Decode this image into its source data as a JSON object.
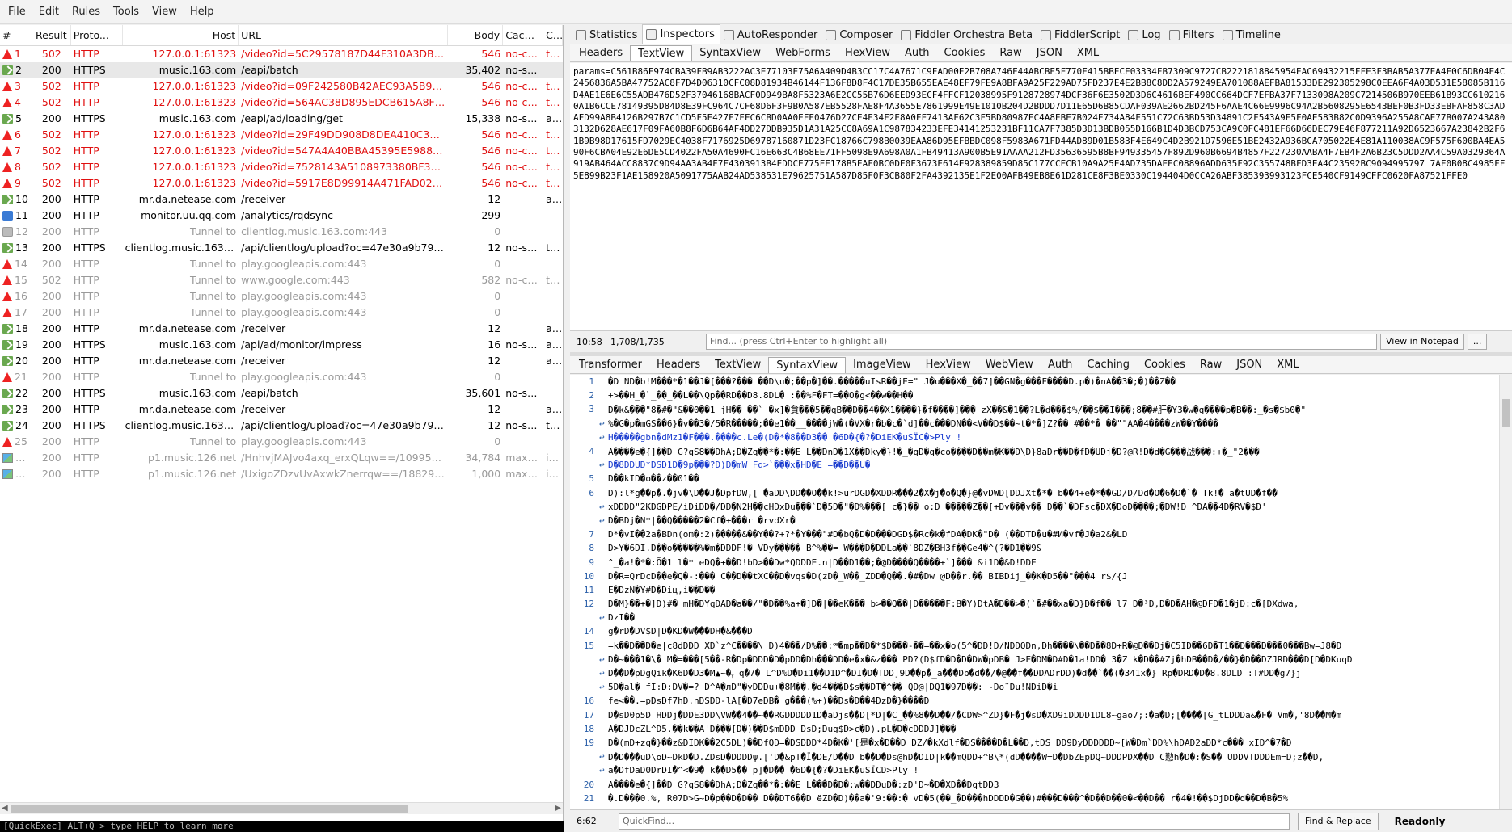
{
  "menu": [
    "File",
    "Edit",
    "Rules",
    "Tools",
    "View",
    "Help"
  ],
  "columns": [
    "#",
    "Result",
    "Proto...",
    "Host",
    "URL",
    "Body",
    "Caching",
    "Conte"
  ],
  "sessions": [
    {
      "icon": "warn",
      "num": "1",
      "result": "502",
      "proto": "HTTP",
      "host": "127.0.0.1:61323",
      "url": "/video?id=5C29578187D44F310A3DB27...",
      "body": "546",
      "caching": "no-ca...",
      "ctype": "text/h",
      "style": "err"
    },
    {
      "icon": "down",
      "num": "2",
      "result": "200",
      "proto": "HTTPS",
      "host": "music.163.com",
      "url": "/eapi/batch",
      "body": "35,402",
      "caching": "no-sto...",
      "ctype": "",
      "style": "sel"
    },
    {
      "icon": "warn",
      "num": "3",
      "result": "502",
      "proto": "HTTP",
      "host": "127.0.0.1:61323",
      "url": "/video?id=09F242580B42AEC93A5B9B6...",
      "body": "546",
      "caching": "no-ca...",
      "ctype": "text/h",
      "style": "err"
    },
    {
      "icon": "warn",
      "num": "4",
      "result": "502",
      "proto": "HTTP",
      "host": "127.0.0.1:61323",
      "url": "/video?id=564AC38D895EDCB615A8F4...",
      "body": "546",
      "caching": "no-ca...",
      "ctype": "text/h",
      "style": "err"
    },
    {
      "icon": "down",
      "num": "5",
      "result": "200",
      "proto": "HTTPS",
      "host": "music.163.com",
      "url": "/eapi/ad/loading/get",
      "body": "15,338",
      "caching": "no-sto...",
      "ctype": "applic",
      "style": ""
    },
    {
      "icon": "warn",
      "num": "6",
      "result": "502",
      "proto": "HTTP",
      "host": "127.0.0.1:61323",
      "url": "/video?id=29F49DD908D8DEA410C3CD...",
      "body": "546",
      "caching": "no-ca...",
      "ctype": "text/h",
      "style": "err"
    },
    {
      "icon": "warn",
      "num": "7",
      "result": "502",
      "proto": "HTTP",
      "host": "127.0.0.1:61323",
      "url": "/video?id=547A4A40BBA45395E598804...",
      "body": "546",
      "caching": "no-ca...",
      "ctype": "text/h",
      "style": "err"
    },
    {
      "icon": "warn",
      "num": "8",
      "result": "502",
      "proto": "HTTP",
      "host": "127.0.0.1:61323",
      "url": "/video?id=7528143A5108973380BF32D...",
      "body": "546",
      "caching": "no-ca...",
      "ctype": "text/h",
      "style": "err"
    },
    {
      "icon": "warn",
      "num": "9",
      "result": "502",
      "proto": "HTTP",
      "host": "127.0.0.1:61323",
      "url": "/video?id=5917E8D99914A471FAD0287...",
      "body": "546",
      "caching": "no-ca...",
      "ctype": "text/h",
      "style": "err"
    },
    {
      "icon": "down",
      "num": "10",
      "result": "200",
      "proto": "HTTP",
      "host": "mr.da.netease.com",
      "url": "/receiver",
      "body": "12",
      "caching": "",
      "ctype": "applic",
      "style": ""
    },
    {
      "icon": "info",
      "num": "11",
      "result": "200",
      "proto": "HTTP",
      "host": "monitor.uu.qq.com",
      "url": "/analytics/rqdsync",
      "body": "299",
      "caching": "",
      "ctype": "",
      "style": ""
    },
    {
      "icon": "tun",
      "num": "12",
      "result": "200",
      "proto": "HTTP",
      "host": "Tunnel to",
      "url": "clientlog.music.163.com:443",
      "body": "0",
      "caching": "",
      "ctype": "",
      "style": "tun"
    },
    {
      "icon": "down",
      "num": "13",
      "result": "200",
      "proto": "HTTPS",
      "host": "clientlog.music.163.com",
      "url": "/api/clientlog/upload?oc=47e30a9b79c...",
      "body": "12",
      "caching": "no-sto...",
      "ctype": "text/p",
      "style": ""
    },
    {
      "icon": "warn",
      "num": "14",
      "result": "200",
      "proto": "HTTP",
      "host": "Tunnel to",
      "url": "play.googleapis.com:443",
      "body": "0",
      "caching": "",
      "ctype": "",
      "style": "tun"
    },
    {
      "icon": "warn",
      "num": "15",
      "result": "502",
      "proto": "HTTP",
      "host": "Tunnel to",
      "url": "www.google.com:443",
      "body": "582",
      "caching": "no-ca...",
      "ctype": "text/h",
      "style": "tun"
    },
    {
      "icon": "warn",
      "num": "16",
      "result": "200",
      "proto": "HTTP",
      "host": "Tunnel to",
      "url": "play.googleapis.com:443",
      "body": "0",
      "caching": "",
      "ctype": "",
      "style": "tun"
    },
    {
      "icon": "warn",
      "num": "17",
      "result": "200",
      "proto": "HTTP",
      "host": "Tunnel to",
      "url": "play.googleapis.com:443",
      "body": "0",
      "caching": "",
      "ctype": "",
      "style": "tun"
    },
    {
      "icon": "down",
      "num": "18",
      "result": "200",
      "proto": "HTTP",
      "host": "mr.da.netease.com",
      "url": "/receiver",
      "body": "12",
      "caching": "",
      "ctype": "applic",
      "style": ""
    },
    {
      "icon": "down",
      "num": "19",
      "result": "200",
      "proto": "HTTPS",
      "host": "music.163.com",
      "url": "/api/ad/monitor/impress",
      "body": "16",
      "caching": "no-sto...",
      "ctype": "applic",
      "style": ""
    },
    {
      "icon": "down",
      "num": "20",
      "result": "200",
      "proto": "HTTP",
      "host": "mr.da.netease.com",
      "url": "/receiver",
      "body": "12",
      "caching": "",
      "ctype": "applic",
      "style": ""
    },
    {
      "icon": "warn",
      "num": "21",
      "result": "200",
      "proto": "HTTP",
      "host": "Tunnel to",
      "url": "play.googleapis.com:443",
      "body": "0",
      "caching": "",
      "ctype": "",
      "style": "tun"
    },
    {
      "icon": "down",
      "num": "22",
      "result": "200",
      "proto": "HTTPS",
      "host": "music.163.com",
      "url": "/eapi/batch",
      "body": "35,601",
      "caching": "no-sto...",
      "ctype": "",
      "style": ""
    },
    {
      "icon": "down",
      "num": "23",
      "result": "200",
      "proto": "HTTP",
      "host": "mr.da.netease.com",
      "url": "/receiver",
      "body": "12",
      "caching": "",
      "ctype": "applic",
      "style": ""
    },
    {
      "icon": "down",
      "num": "24",
      "result": "200",
      "proto": "HTTPS",
      "host": "clientlog.music.163.com",
      "url": "/api/clientlog/upload?oc=47e30a9b79c...",
      "body": "12",
      "caching": "no-sto...",
      "ctype": "text/p",
      "style": ""
    },
    {
      "icon": "warn",
      "num": "25",
      "result": "200",
      "proto": "HTTP",
      "host": "Tunnel to",
      "url": "play.googleapis.com:443",
      "body": "0",
      "caching": "",
      "ctype": "",
      "style": "tun"
    },
    {
      "icon": "img",
      "num": "101",
      "result": "200",
      "proto": "HTTP",
      "host": "p1.music.126.net",
      "url": "/HnhvjMAJvo4axq_erxQLqw==/109951...",
      "body": "34,784",
      "caching": "max-a...",
      "ctype": "image",
      "style": "tun"
    },
    {
      "icon": "img",
      "num": "102",
      "result": "200",
      "proto": "HTTP",
      "host": "p1.music.126.net",
      "url": "/UxigoZDzvUvAxwkZnerrqw==/188291...",
      "body": "1,000",
      "caching": "max-a...",
      "ctype": "image",
      "style": "tun"
    }
  ],
  "quickexec": "[QuickExec] ALT+Q > type HELP to learn more",
  "main_tabs": [
    {
      "label": "Statistics",
      "icon": "stopwatch-icon"
    },
    {
      "label": "Inspectors",
      "icon": "inspector-icon",
      "active": true
    },
    {
      "label": "AutoResponder",
      "icon": "lightning-icon"
    },
    {
      "label": "Composer",
      "icon": "pencil-icon"
    },
    {
      "label": "Fiddler Orchestra Beta",
      "icon": "fo-icon"
    },
    {
      "label": "FiddlerScript",
      "icon": "script-icon"
    },
    {
      "label": "Log",
      "icon": "log-icon"
    },
    {
      "label": "Filters",
      "icon": "checkbox-icon"
    },
    {
      "label": "Timeline",
      "icon": "timeline-icon"
    }
  ],
  "req_tabs": [
    "Headers",
    "TextView",
    "SyntaxView",
    "WebForms",
    "HexView",
    "Auth",
    "Cookies",
    "Raw",
    "JSON",
    "XML"
  ],
  "req_active": "TextView",
  "request_body": "params=C561B86F974CBA39FB9AB3222AC3E77103E75A6A409D4B3CC17C4A7671C9FAD00E2B708A746F44ABCBE5F770F415BBECE03334FB7309C9727CB2221818845954EAC69432215FFE3F3BAB5A377EA4F0C6DB04E4C2456836A5BA47752AC8F7D4D06310CFC08D81934B46144F136F8D8F4C17DE35B655EAE48EF79FE9A8BFA9A25F229AD75FD237E4E2BB8C8DD2A579249EA701088AEFBA81533DE292305298C0EEA6F4A03D531E58085B116D4AE1E6E6C55ADB476D52F37046168BACF0D949BA8F5323A6E2CC55B76D6EED93ECF4FFCF12038995F9128728974DCF36F6E3502D3D6C4616BEF490CC664DCF7EFBA37F7133098A209C7214506B970EEB61B93CC6102160A1B6CCE78149395D84D8E39FC964C7CF68D6F3F9B0A587EB5528FAE8F4A3655E7861999E49E1010B204D2BDDD7D11E65D6B85CDAF039AE2662BD245F6AAE4C66E9996C94A2B5608295E6543BEF0B3FD33EBFAF858C3ADAFD99A8B4126B297B7C1CD5F5E427F7FFC6CBD0AA0EFE0476D27CE4E34F2E8A0FF7413AF62C3F5BD80987EC4A8EBE7B024E734A84E551C72C63BD53D34891C2F543A9E5F0AE583B82C0D9396A255A8CAE77B007A243A803132D628AE617F09FA60B8F6D6B64AF4DD27DDB935D1A31A25CC8A69A1C987834233EFE34141253231BF11CA7F7385D3D13BDB055D166B1D4D3BCD753CA9C0FC481EF66D66DEC79E46F877211A92D6523667A23842B2F61B9B98D17615FD7029EC4038F7176925D69787160871D23FC18766C798B0039EAA86D95EFBBDC098F5983A671FD44AD89D01B583F4E649C4D2B921D7596E51BE2432A936BCA705022E4E81A110038AC9F575F600BA4EA590F6CBA04E92E6DE5CD4022FA50A4690FC16E663C4B68EE71FF5098E9A698A0A1FB49413A900B5E91AAAA212FD35636595B8BF949335457F892D960B6694B4857F227230AABA4F7EB4F2A6B23C5DDD2AA4C59A0329364A919AB464ACC8837C9D94AA3AB4F7F4303913B4EDDCE775FE178B5EAF0BC0DE0F3673E614E928389859D85C177CCECB10A9A25E4AD735DAEEC08896ADD635F92C355748BFD3EA4C23592BC9094995797 7AF0B08C4985FF5E899B23F1AE158920A5091775AAB24AD538531E79625751A587D85F0F3CB80F2FA4392135E1F2E00AFB49EB8E61D281CE8F3BE0330C194404D0CCA26ABF385393993123FCE540CF9149CFFC0620FA87521FFE0",
  "find_pos": "10:58",
  "find_count": "1,708/1,735",
  "find_placeholder": "Find... (press Ctrl+Enter to highlight all)",
  "notepad_btn": "View in Notepad",
  "more_btn": "...",
  "resp_tabs": [
    "Transformer",
    "Headers",
    "TextView",
    "SyntaxView",
    "ImageView",
    "HexView",
    "WebView",
    "Auth",
    "Caching",
    "Cookies",
    "Raw",
    "JSON",
    "XML"
  ],
  "resp_active": "SyntaxView",
  "code_lines": [
    {
      "n": "1",
      "w": "",
      "t": "�D ND�b!M���*�1��J�[���?���  ��D\\u�;��p�]��.�����uIsR��jE=\" J�u���X�_��7]��GN�g���F����D.p�)�nA��3�;�)��Z��",
      "c": ""
    },
    {
      "n": "2",
      "w": "",
      "t": "+>��H_�`_��_��L��\\Qp��RD��D8.8DL� :��%F�FT=��O�g<��w��H��",
      "c": ""
    },
    {
      "n": "3",
      "w": "",
      "t": "D�k&���\"8�#�\"&��0��1 jH�� ��` �x]�貟���5��qB��D��4��X1����}�f����]��� zX��&�1��?L�d���$%/��$��I���;8��#肝�Y3�w�q����p�B��:_�s�$b0�\"",
      "c": ""
    },
    {
      "n": "",
      "w": "↩",
      "t": "  %�G�p�mGS��6}�v��3�/5�R�����;��e1��__����jW�(�VX�r�b�c�`d]��c���DN��<V��D$��~t�*�]Z?��  #��*� ��\"\"AA�4����zW��Y����",
      "c": ""
    },
    {
      "n": "",
      "w": "↩",
      "t": "H�����gbn�dMz1�F���.����c.Le�(D�*�8��D3��   �6D�{�?�DiEK�uSÏC�>Ply    !",
      "c": "blue"
    },
    {
      "n": "4",
      "w": "",
      "t": "A����e�{]��D G?qS8��DhA;D�Zq��*�:��E L��DnD�1X��Dky�}!�_�gD�q�co����D��m�K��D\\D}8aDr��D�fD�UDj�D?@R!D�d�G���战���:+�_\"2���",
      "c": ""
    },
    {
      "n": "",
      "w": "↩",
      "t": "D�8DDUD*DSD1D�9p���?D)D�mW Fd>`���x�HD�E  =��D��U�",
      "c": "blue"
    },
    {
      "n": "5",
      "w": "",
      "t": "D��kID�o��z��01��",
      "c": ""
    },
    {
      "n": "6",
      "w": "",
      "t": "D):l*g��p�.�jv�\\D��J�DpfDW,[  �aDD\\DD��O��k!>urDGD�XDDR���2�X�j�o�Q�}@�vDWD[DDJXt�*�  b��4+e�*��GD/D/Dd�O�6�D�`� Tk!� a�tUD�f��",
      "c": ""
    },
    {
      "n": "",
      "w": "↩",
      "t": "xDDDD\"2KDGDPE/iDiDD�/DD�N2H��cHDxDu���`D�5D�\"�D%���[ c�}�� o:D �����Z��[+Dv���v��    D��`�DFsc�DX�DoD����;�DW!D ^DA��4D�RV�$D'",
      "c": ""
    },
    {
      "n": "",
      "w": "↩",
      "t": "D�BDj�N*|��Q�����2�Cf�+���r    �rvdXr�",
      "c": ""
    },
    {
      "n": "7",
      "w": "",
      "t": "D*�vI��2a�BDn(om�:2)�����&��Y��?+?*�Y���\"#D�bQ�D�D���DGD$�Rc�k�fDA�DK�\"D�   (��DTD�u�#И�vf�J�a2&�LD",
      "c": ""
    },
    {
      "n": "8",
      "w": "",
      "t": "D>Y�6DI.D��o�����%�m�DDDF!� VDy�����   B^%��= W���D�DDLa��`8DZ�BH3f��Ge4�^(?�D1��9&",
      "c": ""
    },
    {
      "n": "9",
      "w": "",
      "t": "^_�a!�*�:Õ�1 l�* eDQ�+��D!bD>��Dw*QDDDE.n|D��D1��;�@D����Q����+`]���  &i1D�&D!DDE",
      "c": ""
    },
    {
      "n": "10",
      "w": "",
      "t": "D�R=QrDcD��e�Q�-:��� C��D��tXC��D�vqs�D(zD�_W��_ZDD�Q��.�#�Dw  @D��r.�� BIBDij_��K�D5��\"���4 r$/{J",
      "c": ""
    },
    {
      "n": "11",
      "w": "",
      "t": "E�DzN�Y#D�Diц,i��D��",
      "c": ""
    },
    {
      "n": "12",
      "w": "",
      "t": "D�M}��+�]D)#� mH�DYqDAD�a��/\"�D��%a+�]D�|��eK��� b>��Q��|D�����F:B�Y)DtA�D��>�(`�#��xa�D}D�f�� l7 D�³D,D�D�AH�@DFD�1�jD:c�[DXdwa,",
      "c": ""
    },
    {
      "n": "",
      "w": "↩",
      "t": "DzI��",
      "c": ""
    },
    {
      "n": "14",
      "w": "",
      "t": "g�rD�DV$D|D�KD�W���DH�&���D",
      "c": ""
    },
    {
      "n": "15",
      "w": "",
      "t": "=k��D��D�e|c8dDDD XD`z^C����\\ D)4���/D%��:ꟹ�mp��D�*$D���-��=��x�o(5^�DD!D/NDDQDn,Dh����\\��D��8D+R�@D��Dj�C5ID��6D�T1��D���D���0���Bw=J8�D",
      "c": ""
    },
    {
      "n": "",
      "w": "↩",
      "t": "D�~���1�\\� M�=���[5��-R�Dp�DDD�D�pDD�Dh���DD�e�x�&z��� PD?(D$fD�D�D�DW�pDB� J>E�DM�D#D�1a!DD� 3�Z k�D��#Zj�hDB��D�/��}�D��DZJRD���D[D�DKuqD",
      "c": ""
    },
    {
      "n": "",
      "w": "↩",
      "t": "D��D�pDgQik�K6D�D3�M▲~�ᵧ q�7� L^D%D�Di1��D1D^�DI�D�TDD]9D��p�_a���Db�d��/�@��f��DDADrDD)�d��`��(�341x�} Rp�DRD�D�8.8DLD :T#DD�g7}j",
      "c": ""
    },
    {
      "n": "",
      "w": "↩",
      "t": "5D�al� fI:D:DV�=? D^A�лD\"�yDDDu+�8M��.�d4���D$s��DT�^�� QD@|DQ1�97D��:  -Do˜Du!NDiD�i",
      "c": ""
    },
    {
      "n": "16",
      "w": "",
      "t": "fe<��.=pDsDf7hD.nDSDD-lA[�D7eDB� g���(%+)��Ds�D��4DzD�}����D",
      "c": ""
    },
    {
      "n": "17",
      "w": "",
      "t": "D�sD0p5D HDDj�DDE3DD\\VW��4��~��RGDDDDD1D�aDjs��D[*D|�C_��%8��D��/�CDW>^ZD}�F�j�sD�XD9iDDDD1DL8~gao7;:�a�D;[����[G_tLDDDa&�F� Vm�,'8D��M�m",
      "c": ""
    },
    {
      "n": "18",
      "w": "",
      "t": "A�DJDcZL^D5.��k��A'D���[D�)��D$mDDD DsD;Dug$D>c�D).pL�D�cDDDJ]���",
      "c": ""
    },
    {
      "n": "19",
      "w": "",
      "t": "D�(mD+zq�}��z&DIDK��2C5DL)��DfQD=�DSDDD*4D�K�'[是�x�D��D    DZ/�kXdlf�DS����D�L��D,tDS    DD9DyDDDDDD~[W�Dm`DD%\\hDAD2aDD*c��� xID^�7�D",
      "c": ""
    },
    {
      "n": "",
      "w": "↩",
      "t": "D�D���uD\\oD~DkD�D.ZDsD�DDDDψ.['D�&pT�Ï�DE/D��D b��D�Ds@hD�DID|k��mQDD+^B\\*(dD����W=D�DbZEpDQ~DDDPDX��D C懃h�D�:�S�� UDDVTDDDEm=D;z��D,",
      "c": ""
    },
    {
      "n": "",
      "w": "↩",
      "t": "a�DfDaD0DrDI�^<�9� k��D5�� p]�D�� �6D�{�?�DiEK�uSÏCD>Ply  !",
      "c": ""
    },
    {
      "n": "20",
      "w": "",
      "t": "A����e�{]��D G?qS8��DhA;D�Zq��*�:��E L���D�D�:w��DDuD�:zD'D~�D�XD��DqtDD3",
      "c": ""
    },
    {
      "n": "21",
      "w": "",
      "t": "�.D���0.%, R07D>G~D�p��D�D�� D��DT6��D ёZD�D)��a�'9:��:� vD�5(��_�D���hDDDD�G��)#���D���^�D��D��0�<��D�� r�4�!��$DjDD�d��D�B�5%",
      "c": ""
    }
  ],
  "status_pos": "6:62",
  "quickfind_placeholder": "QuickFind...",
  "replace_btn": "Find & Replace",
  "readonly": "Readonly"
}
